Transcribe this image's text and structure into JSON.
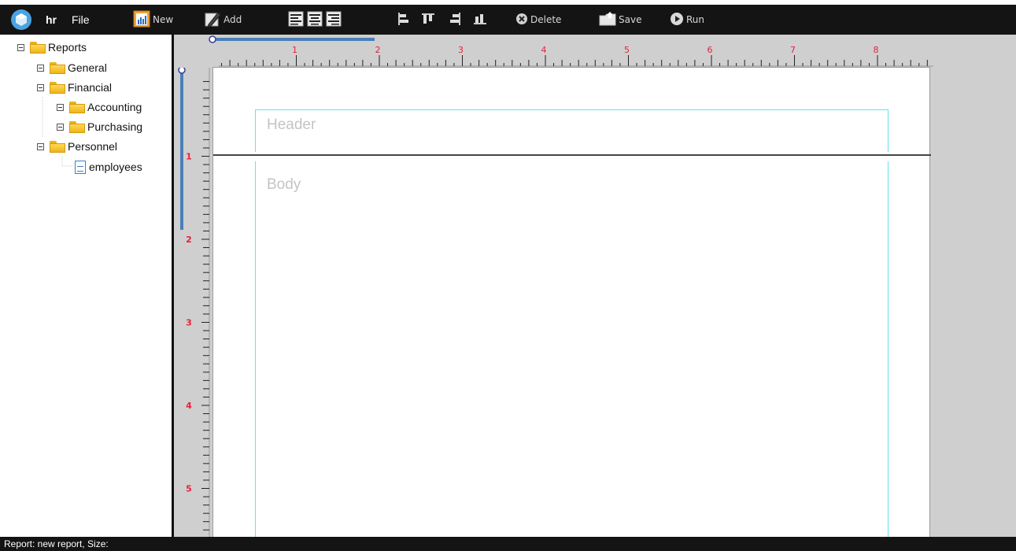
{
  "app": {
    "title": "hr",
    "menu_file": "File"
  },
  "toolbar": {
    "new_label": "New",
    "add_label": "Add",
    "delete_label": "Delete",
    "save_label": "Save",
    "run_label": "Run",
    "align_icons": [
      "align-left-icon",
      "align-center-icon",
      "align-right-icon"
    ],
    "position_icons": [
      "align-left-edge-icon",
      "align-top-edge-icon",
      "align-right-edge-icon",
      "align-bottom-edge-icon"
    ]
  },
  "tree": {
    "root": "Reports",
    "items": [
      {
        "label": "General"
      },
      {
        "label": "Financial"
      },
      {
        "label": "Accounting"
      },
      {
        "label": "Purchasing"
      },
      {
        "label": "Personnel"
      },
      {
        "label": "employees"
      }
    ]
  },
  "rulers": {
    "h_numbers": [
      "1",
      "2",
      "3",
      "4",
      "5",
      "6",
      "7",
      "8"
    ],
    "v_numbers": [
      "1",
      "2",
      "3",
      "4",
      "5"
    ]
  },
  "report": {
    "header_label": "Header",
    "body_label": "Body"
  },
  "status": {
    "text": "Report: new report, Size:"
  },
  "colors": {
    "toolbar_bg": "#141414",
    "workspace_bg": "#cfcfcf",
    "band_border": "#5fe6ee",
    "ruler_number": "#e8203c",
    "slider": "#4a7fb8"
  }
}
